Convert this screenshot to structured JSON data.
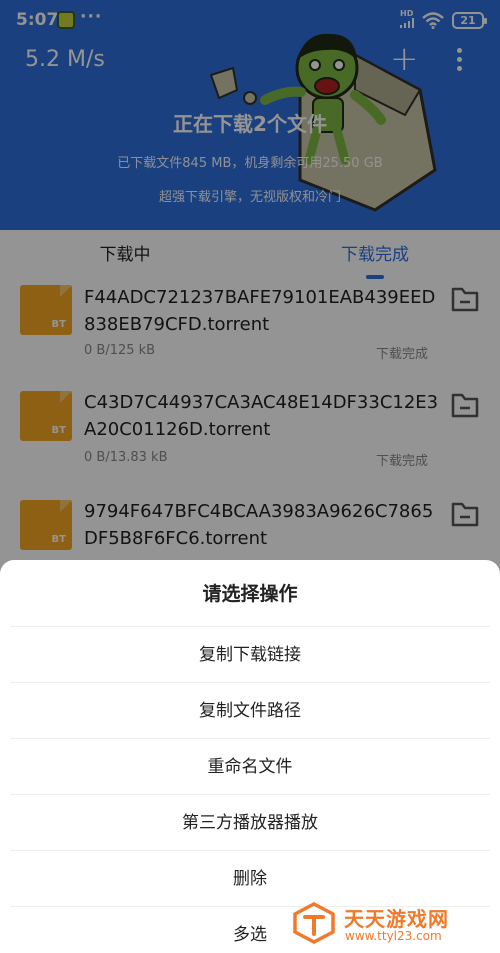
{
  "status_bar": {
    "time": "5:07",
    "dots": "···",
    "network_tag": "HD",
    "battery": "21"
  },
  "header": {
    "speed": "5.2 M/s",
    "add_label": "+",
    "title": "正在下载2个文件",
    "subtitle": "已下载文件845 MB，机身剩余可用25.50 GB",
    "slogan": "超强下载引擎，无视版权和冷门",
    "bg_color": "#2f6fdc"
  },
  "tabs": [
    {
      "label": "下载中",
      "active": false
    },
    {
      "label": "下载完成",
      "active": true
    }
  ],
  "files": [
    {
      "name": "F44ADC721237BAFE79101EAB439EED838EB79CFD.torrent",
      "size": "0 B/125 kB",
      "status": "下载完成",
      "type": "BT"
    },
    {
      "name": "C43D7C44937CA3AC48E14DF33C12E3A20C01126D.torrent",
      "size": "0 B/13.83 kB",
      "status": "下载完成",
      "type": "BT"
    },
    {
      "name": "9794F647BFC4BCAA3983A9626C7865DF5B8F6FC6.torrent",
      "size": "",
      "status": "",
      "type": "BT"
    }
  ],
  "sheet": {
    "title": "请选择操作",
    "actions": [
      "复制下载链接",
      "复制文件路径",
      "重命名文件",
      "第三方播放器播放",
      "删除",
      "多选"
    ]
  },
  "watermark": {
    "name": "天天游戏网",
    "url": "www.ttyl23.com"
  },
  "icons": {
    "file": "bt-file-icon",
    "folder": "folder-icon",
    "more": "kebab-icon",
    "add": "plus-icon"
  }
}
